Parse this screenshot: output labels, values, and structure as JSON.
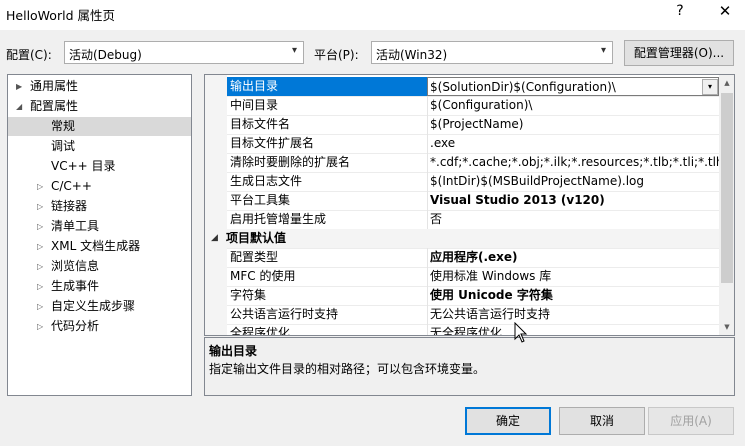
{
  "window": {
    "title": "HelloWorld 属性页",
    "help": "?",
    "close": "✕"
  },
  "config": {
    "label": "配置(C):",
    "value": "活动(Debug)"
  },
  "platform": {
    "label": "平台(P):",
    "value": "活动(Win32)"
  },
  "manager_button": "配置管理器(O)...",
  "tree": [
    {
      "label": "通用属性",
      "twist": "▶"
    },
    {
      "label": "配置属性",
      "twist": "◢"
    },
    {
      "label": "常规",
      "twist": ""
    },
    {
      "label": "调试",
      "twist": ""
    },
    {
      "label": "VC++ 目录",
      "twist": ""
    },
    {
      "label": "C/C++",
      "twist": "▷"
    },
    {
      "label": "链接器",
      "twist": "▷"
    },
    {
      "label": "清单工具",
      "twist": "▷"
    },
    {
      "label": "XML 文档生成器",
      "twist": "▷"
    },
    {
      "label": "浏览信息",
      "twist": "▷"
    },
    {
      "label": "生成事件",
      "twist": "▷"
    },
    {
      "label": "自定义生成步骤",
      "twist": "▷"
    },
    {
      "label": "代码分析",
      "twist": "▷"
    }
  ],
  "properties": [
    {
      "name": "输出目录",
      "value": "$(SolutionDir)$(Configuration)\\"
    },
    {
      "name": "中间目录",
      "value": "$(Configuration)\\"
    },
    {
      "name": "目标文件名",
      "value": "$(ProjectName)"
    },
    {
      "name": "目标文件扩展名",
      "value": ".exe"
    },
    {
      "name": "清除时要删除的扩展名",
      "value": "*.cdf;*.cache;*.obj;*.ilk;*.resources;*.tlb;*.tli;*.tlh;*.tmp"
    },
    {
      "name": "生成日志文件",
      "value": "$(IntDir)$(MSBuildProjectName).log"
    },
    {
      "name": "平台工具集",
      "value": "Visual Studio 2013 (v120)"
    },
    {
      "name": "启用托管增量生成",
      "value": "否"
    },
    {
      "name": "项目默认值",
      "value": ""
    },
    {
      "name": "配置类型",
      "value": "应用程序(.exe)"
    },
    {
      "name": "MFC 的使用",
      "value": "使用标准 Windows 库"
    },
    {
      "name": "字符集",
      "value": "使用 Unicode 字符集"
    },
    {
      "name": "公共语言运行时支持",
      "value": "无公共语言运行时支持"
    },
    {
      "name": "全程序优化",
      "value": "无全程序优化"
    }
  ],
  "description": {
    "title": "输出目录",
    "text": "指定输出文件目录的相对路径；可以包含环境变量。"
  },
  "buttons": {
    "ok": "确定",
    "cancel": "取消",
    "apply": "应用(A)"
  },
  "icons": {
    "dropdown": "▾",
    "expand": "◢",
    "collapse": "▶",
    "scroll_up": "▲",
    "scroll_down": "▼"
  }
}
